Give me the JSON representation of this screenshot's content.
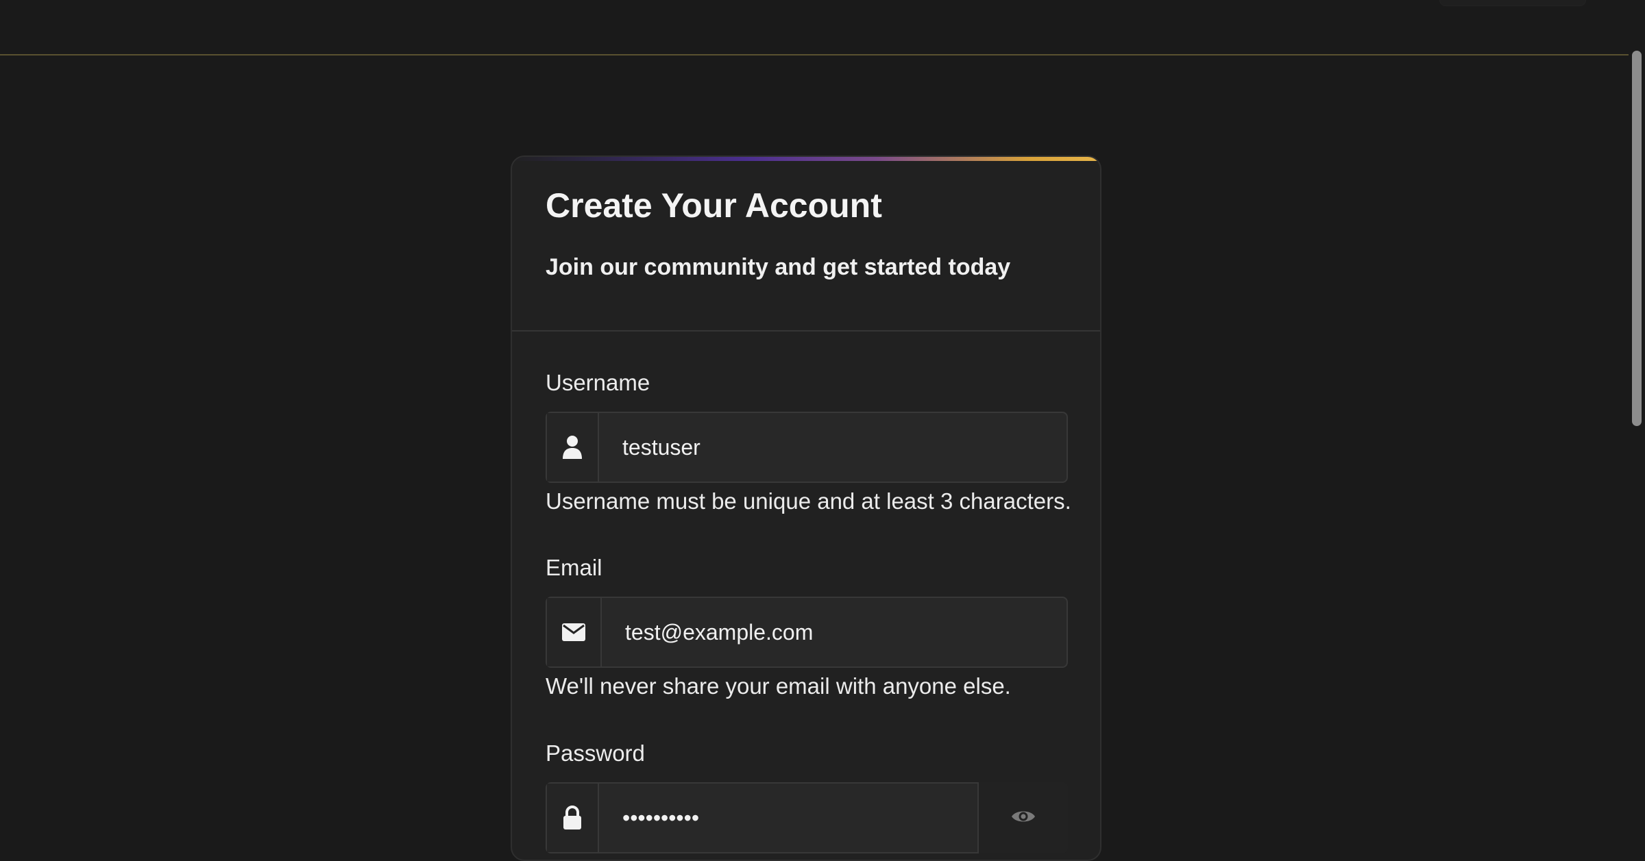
{
  "page": {
    "accent_gradient": [
      "#4b2f8f",
      "#7a4a8a",
      "#e7b54a"
    ],
    "background": "#1a1a1a"
  },
  "card": {
    "title": "Create Your Account",
    "subtitle": "Join our community and get started today"
  },
  "form": {
    "username": {
      "label": "Username",
      "value": "testuser",
      "help": "Username must be unique and at least 3 characters.",
      "icon": "user-icon"
    },
    "email": {
      "label": "Email",
      "value": "test@example.com",
      "help": "We'll never share your email with anyone else.",
      "icon": "envelope-icon"
    },
    "password": {
      "label": "Password",
      "value": "••••••••••",
      "icon": "lock-icon",
      "toggle_icon": "eye-icon"
    }
  }
}
